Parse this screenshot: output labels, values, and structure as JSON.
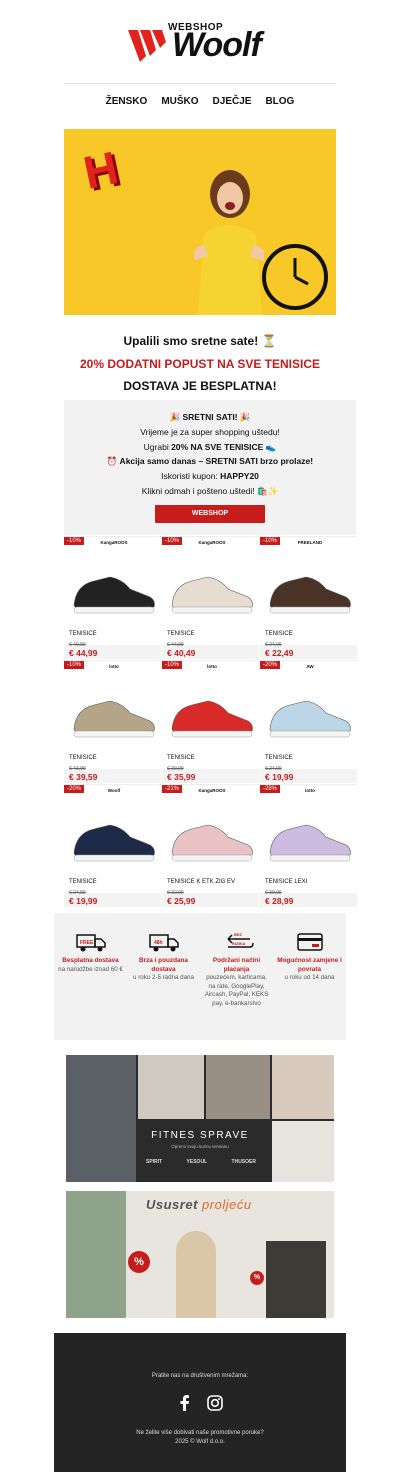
{
  "logo": {
    "small": "WEBSHOP",
    "big": "Woolf"
  },
  "nav": [
    "ŽENSKO",
    "MUŠKO",
    "DJEČJE",
    "BLOG"
  ],
  "hero": {
    "letter": "H"
  },
  "headlines": {
    "line1": "Upalili smo sretne sate! ⏳",
    "line2": "20% DODATNI POPUST NA SVE TENISICE",
    "line3": "DOSTAVA JE BESPLATNA!"
  },
  "promo": {
    "l1": "🎉 SRETNI SATI! 🎉",
    "l2": "Vrijeme je za super shopping uštedu!",
    "l3a": "Ugrabi ",
    "l3b": "20% NA SVE TENISICE",
    "l3c": " 👟",
    "l4": "⏰ Akcija samo danas – SRETNI SATI brzo prolaze!",
    "l5a": "Iskoristi kupon: ",
    "l5b": "HAPPY20",
    "l6": "Klikni odmah i pošteno uštedi! 🛍️✨",
    "button": "WEBSHOP"
  },
  "products": [
    {
      "disc": "-10%",
      "brand": "KangaROOS",
      "name": "TENISICE",
      "old": "€ 49,99",
      "new": "€ 44,99",
      "color": "#222"
    },
    {
      "disc": "-10%",
      "brand": "KangaROOS",
      "name": "TENISICE",
      "old": "€ 44,99",
      "new": "€ 40,49",
      "color": "#e6ddd0"
    },
    {
      "disc": "-10%",
      "brand": "FREELAND",
      "name": "TENISICE",
      "old": "€ 24,99",
      "new": "€ 22,49",
      "color": "#4a3326"
    },
    {
      "disc": "-10%",
      "brand": "lotto",
      "name": "TENISICE",
      "old": "€ 43,99",
      "new": "€ 39,59",
      "color": "#b4a488"
    },
    {
      "disc": "-10%",
      "brand": "lotto",
      "name": "TENISICE",
      "old": "€ 39,99",
      "new": "€ 35,99",
      "color": "#d92a2a"
    },
    {
      "disc": "-20%",
      "brand": "AW",
      "name": "TENISICE",
      "old": "€ 24,99",
      "new": "€ 19,99",
      "color": "#bcd6e8"
    },
    {
      "disc": "-20%",
      "brand": "Woolf",
      "name": "TENISICE",
      "old": "€ 24,99",
      "new": "€ 19,99",
      "color": "#1d2b48"
    },
    {
      "disc": "-21%",
      "brand": "KangaROOS",
      "name": "TENISICE K ETK ZIG EV",
      "old": "€ 32,99",
      "new": "€ 25,99",
      "color": "#e9c2c4"
    },
    {
      "disc": "-28%",
      "brand": "lotto",
      "name": "TENISICE LEXI",
      "old": "€ 39,99",
      "new": "€ 28,99",
      "color": "#cdbbe0"
    }
  ],
  "benefits": [
    {
      "title": "Besplatna dostava",
      "text": "na narudžbe iznad 60 €",
      "badge": "FREE"
    },
    {
      "title": "Brza i pouzdana dostava",
      "text": "u roku 2-5 radna dana",
      "badge": "48h"
    },
    {
      "title": "Podržani načini plaćanja",
      "text": "pouzećem, karticama, na rate, GooglePlay, Aircash, PayPal, KEKS pay, e-bankarstvo",
      "badge": "BEZ RIZIKA"
    },
    {
      "title": "Mogućnost zamjene i povrata",
      "text": "u roku od 14 dana",
      "badge": ""
    }
  ],
  "banner_fitness": {
    "title": "FITNES SPRAVE",
    "sub": "Opremi svoju kućnu teretanu",
    "brands": [
      "SPIRIT",
      "YESOUL",
      "THUSOER"
    ]
  },
  "banner_room": {
    "title_a": "Ususret ",
    "title_b": "proljeću",
    "badge": "%"
  },
  "footer": {
    "social_text": "Pratite nas na društvenim mrežama:",
    "unsub": "Ne želite više dobivati naše promotivne poruke?",
    "copy": "2025 © Wolf d.o.o."
  },
  "colors": {
    "accent": "#c61c1c",
    "hero_bg": "#f8c829"
  }
}
